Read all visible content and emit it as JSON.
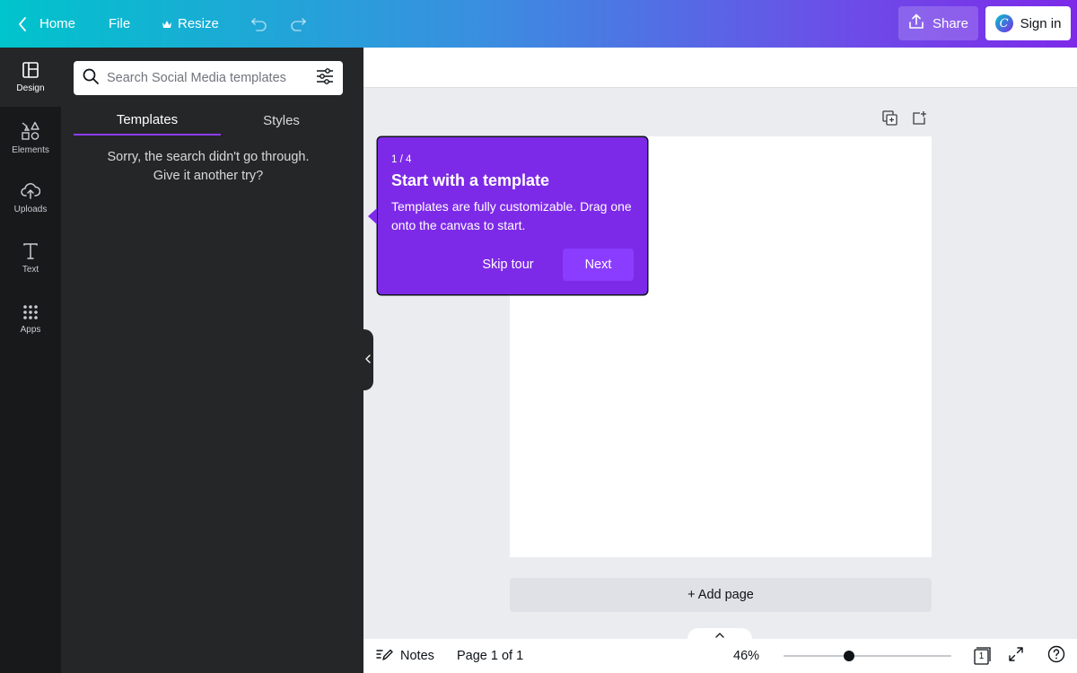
{
  "topbar": {
    "home_label": "Home",
    "file_label": "File",
    "resize_label": "Resize",
    "share_label": "Share",
    "signin_label": "Sign in"
  },
  "rail": {
    "items": [
      {
        "label": "Design",
        "icon": "layout-icon"
      },
      {
        "label": "Elements",
        "icon": "shapes-icon"
      },
      {
        "label": "Uploads",
        "icon": "cloud-upload-icon"
      },
      {
        "label": "Text",
        "icon": "text-icon"
      },
      {
        "label": "Apps",
        "icon": "apps-grid-icon"
      }
    ]
  },
  "panel": {
    "search_placeholder": "Search Social Media templates",
    "tabs": [
      "Templates",
      "Styles"
    ],
    "empty_line1": "Sorry, the search didn't go through.",
    "empty_line2": "Give it another try?"
  },
  "tour": {
    "step": "1 / 4",
    "title": "Start with a template",
    "body": "Templates are fully customizable. Drag one onto the canvas to start.",
    "skip_label": "Skip tour",
    "next_label": "Next"
  },
  "canvas": {
    "add_page_label": "+ Add page"
  },
  "bottombar": {
    "notes_label": "Notes",
    "page_indicator": "Page 1 of 1",
    "zoom_level": "46%",
    "zoom_fraction": 0.39,
    "page_count_badge": "1"
  },
  "colors": {
    "accent": "#7d2ae8",
    "button": "#8b3dff",
    "gradient_start": "#00c4cc",
    "gradient_end": "#7d2ae8"
  }
}
